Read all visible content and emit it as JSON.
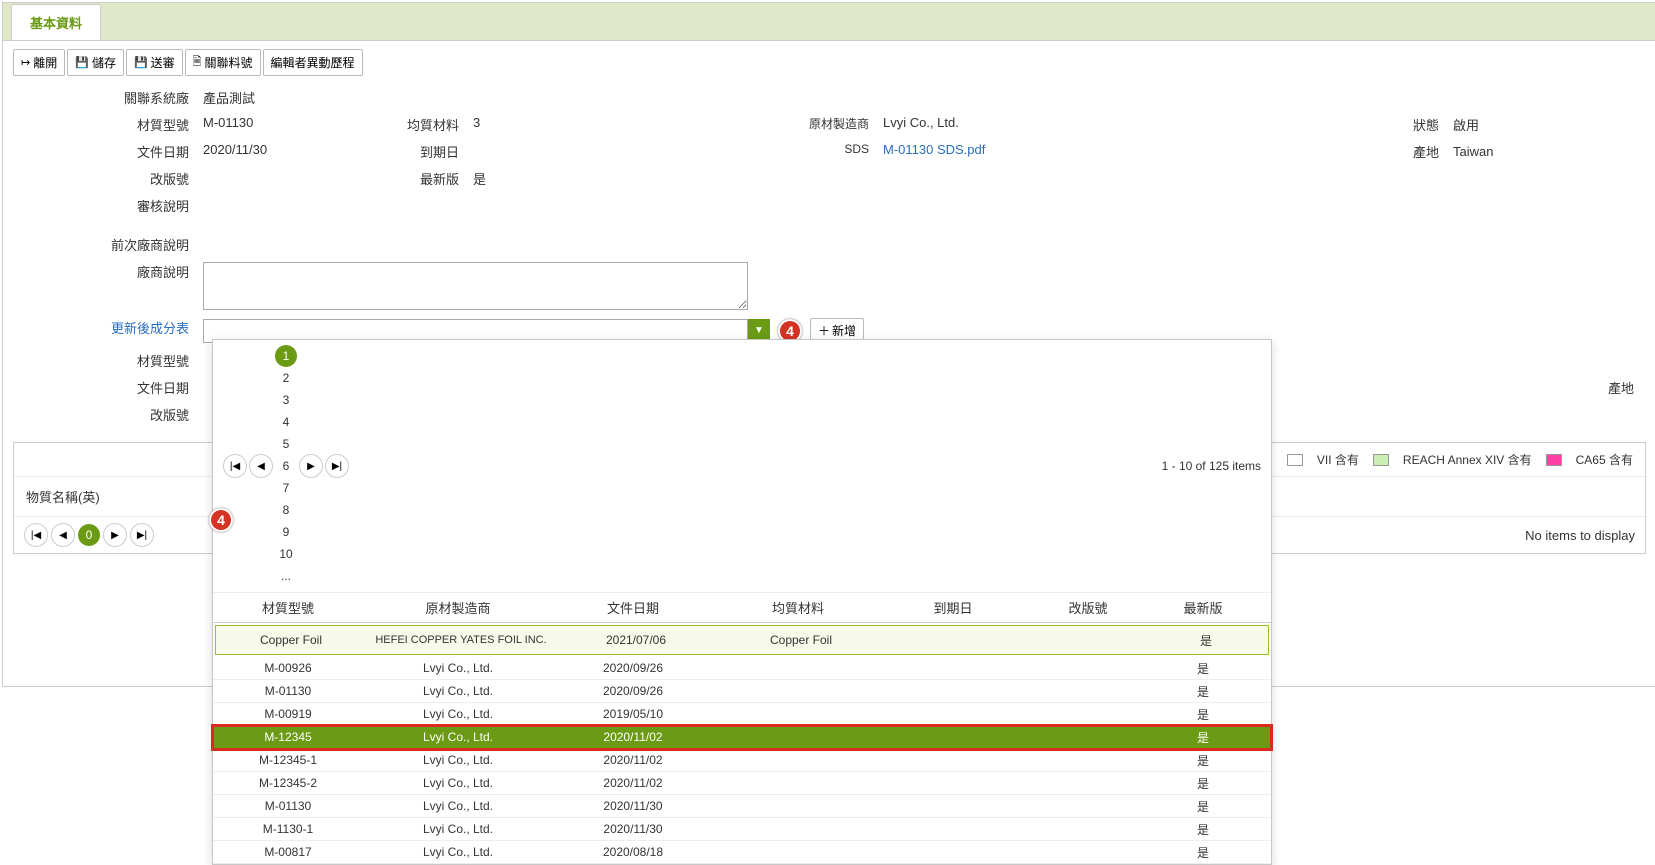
{
  "tab": {
    "basic": "基本資料"
  },
  "toolbar": {
    "leave": "離開",
    "save": "儲存",
    "submit": "送審",
    "link": "關聯料號",
    "history": "編輯者異動歷程"
  },
  "form": {
    "sysfactory_lbl": "關聯系統廠",
    "sysfactory_val": "產品測試",
    "matno_lbl": "材質型號",
    "matno_val": "M-01130",
    "homo_lbl": "均質材料",
    "homo_val": "3",
    "mfr_lbl": "原材製造商",
    "mfr_val": "Lvyi Co., Ltd.",
    "status_lbl": "狀態",
    "status_val": "啟用",
    "docdate_lbl": "文件日期",
    "docdate_val": "2020/11/30",
    "expdate_lbl": "到期日",
    "expdate_val": "",
    "sds_lbl": "SDS",
    "sds_val": "M-01130 SDS.pdf",
    "origin_lbl": "產地",
    "origin_val": "Taiwan",
    "rev_lbl": "改版號",
    "rev_val": "",
    "latest_lbl": "最新版",
    "latest_val": "是",
    "audit_lbl": "審核說明",
    "audit_val": "",
    "prev_lbl": "前次廠商說明",
    "prev_val": "",
    "vendor_lbl": "廠商說明",
    "updatecomp_lbl": "更新後成分表",
    "add_btn": "新增"
  },
  "secondary": {
    "matno_lbl": "材質型號",
    "docdate_lbl": "文件日期",
    "rev_lbl": "改版號",
    "origin_lbl": "產地"
  },
  "dropdown": {
    "page_info": "1 - 10 of 125 items",
    "pages": [
      "1",
      "2",
      "3",
      "4",
      "5",
      "6",
      "7",
      "8",
      "9",
      "10",
      "..."
    ],
    "headers": {
      "mat": "材質型號",
      "mfr": "原材製造商",
      "date": "文件日期",
      "homo": "均質材料",
      "exp": "到期日",
      "rev": "改版號",
      "latest": "最新版"
    },
    "rows": [
      {
        "mat": "Copper Foil",
        "mfr": "HEFEI COPPER YATES FOIL INC.",
        "date": "2021/07/06",
        "homo": "Copper Foil",
        "exp": "",
        "rev": "",
        "latest": "是",
        "first": true
      },
      {
        "mat": "M-00926",
        "mfr": "Lvyi Co., Ltd.",
        "date": "2020/09/26",
        "homo": "",
        "exp": "",
        "rev": "",
        "latest": "是"
      },
      {
        "mat": "M-01130",
        "mfr": "Lvyi Co., Ltd.",
        "date": "2020/09/26",
        "homo": "",
        "exp": "",
        "rev": "",
        "latest": "是"
      },
      {
        "mat": "M-00919",
        "mfr": "Lvyi Co., Ltd.",
        "date": "2019/05/10",
        "homo": "",
        "exp": "",
        "rev": "",
        "latest": "是"
      },
      {
        "mat": "M-12345",
        "mfr": "Lvyi Co., Ltd.",
        "date": "2020/11/02",
        "homo": "",
        "exp": "",
        "rev": "",
        "latest": "是",
        "selected": true
      },
      {
        "mat": "M-12345-1",
        "mfr": "Lvyi Co., Ltd.",
        "date": "2020/11/02",
        "homo": "",
        "exp": "",
        "rev": "",
        "latest": "是"
      },
      {
        "mat": "M-12345-2",
        "mfr": "Lvyi Co., Ltd.",
        "date": "2020/11/02",
        "homo": "",
        "exp": "",
        "rev": "",
        "latest": "是"
      },
      {
        "mat": "M-01130",
        "mfr": "Lvyi Co., Ltd.",
        "date": "2020/11/30",
        "homo": "",
        "exp": "",
        "rev": "",
        "latest": "是"
      },
      {
        "mat": "M-1130-1",
        "mfr": "Lvyi Co., Ltd.",
        "date": "2020/11/30",
        "homo": "",
        "exp": "",
        "rev": "",
        "latest": "是"
      },
      {
        "mat": "M-00817",
        "mfr": "Lvyi Co., Ltd.",
        "date": "2020/08/18",
        "homo": "",
        "exp": "",
        "rev": "",
        "latest": "是"
      }
    ]
  },
  "callouts": {
    "a": "4",
    "b": "4"
  },
  "legend": {
    "a": "VII 含有",
    "b": "REACH Annex XIV 含有",
    "c": "CA65 含有"
  },
  "lower": {
    "substance_lbl": "物質名稱(英)",
    "noitems": "No items to display",
    "page0": "0"
  }
}
